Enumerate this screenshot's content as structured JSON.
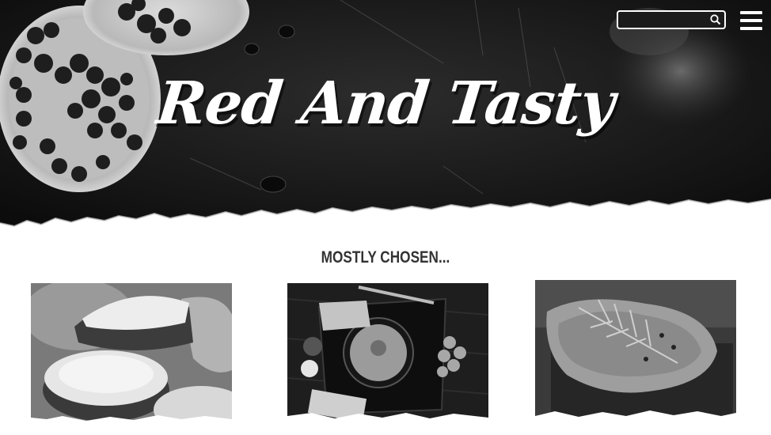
{
  "header": {
    "title": "Red And Tasty",
    "search": {
      "value": "",
      "placeholder": "",
      "icon": "search-icon"
    },
    "menu": {
      "icon": "hamburger-menu-icon"
    }
  },
  "section": {
    "title": "MOSTLY CHOSEN..."
  },
  "cards": [
    {
      "name": "cookies-photo"
    },
    {
      "name": "soup-photo"
    },
    {
      "name": "steak-photo"
    }
  ],
  "colors": {
    "hero_background": "#1c1c1c",
    "title": "#ffffff",
    "section_title": "#333333",
    "page_background": "#ffffff"
  }
}
